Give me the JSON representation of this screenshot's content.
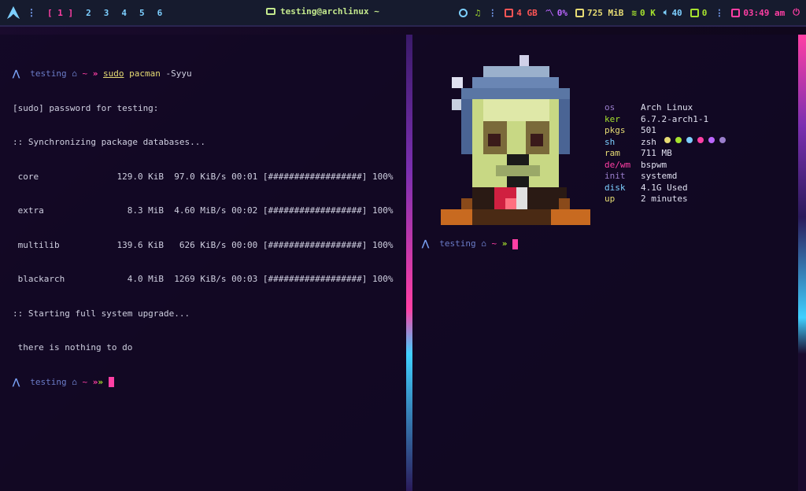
{
  "topbar": {
    "workspaces": [
      {
        "label": "[ 1 ]",
        "active": true
      },
      {
        "label": "2",
        "active": false
      },
      {
        "label": "3",
        "active": false
      },
      {
        "label": "4",
        "active": false
      },
      {
        "label": "5",
        "active": false
      },
      {
        "label": "6",
        "active": false
      }
    ],
    "window_title": "testing@archlinux ~",
    "modules": {
      "disk": "4 GB",
      "cpu": "0%",
      "memory": "725 MiB",
      "network": "0 K",
      "volume": "40",
      "updates": "0",
      "time": "03:49 am"
    }
  },
  "left_terminal": {
    "prompt": {
      "user": "testing",
      "dir": "~"
    },
    "command": {
      "sudo": "sudo",
      "pacman": "pacman",
      "args": "-Syyu"
    },
    "output": [
      "[sudo] password for testing:",
      ":: Synchronizing package databases...",
      " core               129.0 KiB  97.0 KiB/s 00:01 [##################] 100%",
      " extra                8.3 MiB  4.60 MiB/s 00:02 [##################] 100%",
      " multilib           139.6 KiB   626 KiB/s 00:00 [##################] 100%",
      " blackarch            4.0 MiB  1269 KiB/s 00:03 [##################] 100%",
      ":: Starting full system upgrade...",
      " there is nothing to do"
    ]
  },
  "right_terminal": {
    "fetch": [
      {
        "key": "os",
        "value": "Arch Linux",
        "color": "#9aa5ce"
      },
      {
        "key": "ker",
        "value": "6.7.2-arch1-1",
        "color": "#a6e22e"
      },
      {
        "key": "pkgs",
        "value": "501",
        "color": "#e6db74"
      },
      {
        "key": "sh",
        "value": "zsh",
        "color": "#7dcfff"
      },
      {
        "key": "ram",
        "value": "711 MB",
        "color": "#e6db74"
      },
      {
        "key": "de/wm",
        "value": "bspwm",
        "color": "#ff3fa4"
      },
      {
        "key": "init",
        "value": "systemd",
        "color": "#9a7ecc"
      },
      {
        "key": "disk",
        "value": "4.1G Used",
        "color": "#7dcfff"
      },
      {
        "key": "up",
        "value": "2 minutes",
        "color": "#e6db74"
      }
    ],
    "prompt": {
      "user": "testing",
      "dir": "~"
    }
  }
}
